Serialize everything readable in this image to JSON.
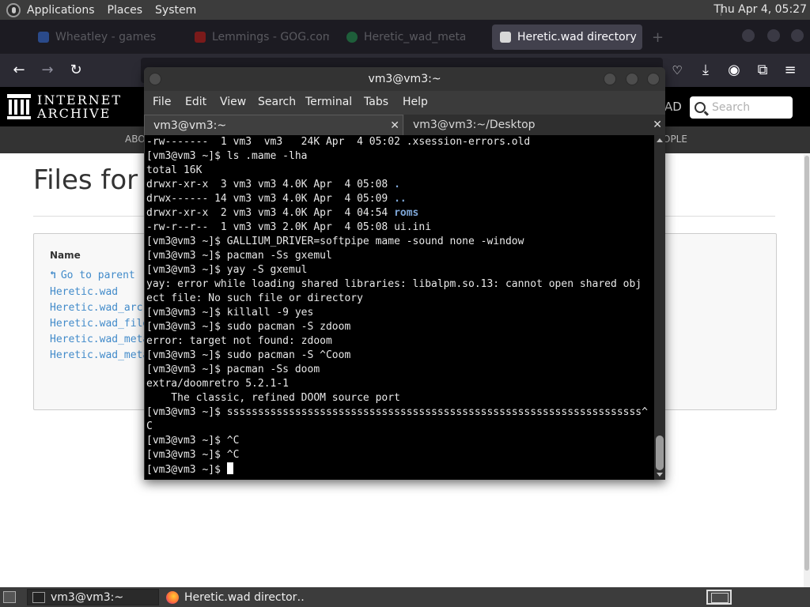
{
  "top_panel": {
    "menus": [
      "Applications",
      "Places",
      "System"
    ],
    "clock": "Thu Apr  4, 05:27"
  },
  "browser": {
    "tabs": [
      {
        "label": "Wheatley - games",
        "active": false
      },
      {
        "label": "Lemmings - GOG.com",
        "active": false
      },
      {
        "label": "Heretic_wad_metadata",
        "active": false
      },
      {
        "label": "Heretic.wad directory",
        "active": true
      }
    ],
    "new_tab": "+"
  },
  "ia_page": {
    "wordmark_line1": "INTERNET",
    "wordmark_line2": "ARCHIVE",
    "search_placeholder": "Search",
    "header_fragment": "AD",
    "subnav_left": "ABO",
    "subnav_right": "OPLE",
    "title": "Files for",
    "files_header": "Name",
    "parent_link": "Go to parent",
    "files": [
      "Heretic.wad",
      "Heretic.wad_arc",
      "Heretic.wad_file",
      "Heretic.wad_meta",
      "Heretic.wad_meta"
    ]
  },
  "terminal": {
    "title": "vm3@vm3:~",
    "menus": [
      "File",
      "Edit",
      "View",
      "Search",
      "Terminal",
      "Tabs",
      "Help"
    ],
    "tabs": [
      {
        "label": "vm3@vm3:~",
        "active": true
      },
      {
        "label": "vm3@vm3:~/Desktop",
        "active": false
      }
    ],
    "lines": [
      {
        "text": "-rw-------  1 vm3  vm3   24K Apr  4 05:02 .xsession-errors.old"
      },
      {
        "text": "[vm3@vm3 ~]$ ls .mame -lha"
      },
      {
        "text": "total 16K"
      },
      {
        "text": "drwxr-xr-x  3 vm3 vm3 4.0K Apr  4 05:08 ",
        "dir": "."
      },
      {
        "text": "drwx------ 14 vm3 vm3 4.0K Apr  4 05:09 ",
        "dir": ".."
      },
      {
        "text": "drwxr-xr-x  2 vm3 vm3 4.0K Apr  4 04:54 ",
        "dir": "roms"
      },
      {
        "text": "-rw-r--r--  1 vm3 vm3 2.0K Apr  4 05:08 ui.ini"
      },
      {
        "text": "[vm3@vm3 ~]$ GALLIUM_DRIVER=softpipe mame -sound none -window"
      },
      {
        "text": "[vm3@vm3 ~]$ pacman -Ss gxemul"
      },
      {
        "text": "[vm3@vm3 ~]$ yay -S gxemul"
      },
      {
        "text": "yay: error while loading shared libraries: libalpm.so.13: cannot open shared obj"
      },
      {
        "text": "ect file: No such file or directory"
      },
      {
        "text": "[vm3@vm3 ~]$ killall -9 yes"
      },
      {
        "text": "[vm3@vm3 ~]$ sudo pacman -S zdoom"
      },
      {
        "text": "error: target not found: zdoom"
      },
      {
        "text": "[vm3@vm3 ~]$ sudo pacman -S ^Coom"
      },
      {
        "text": "[vm3@vm3 ~]$ pacman -Ss doom"
      },
      {
        "text": "extra/doomretro 5.2.1-1"
      },
      {
        "text": "    The classic, refined DOOM source port"
      },
      {
        "text": "[vm3@vm3 ~]$ sssssssssssssssssssssssssssssssssssssssssssssssssssssssssssssssssss^"
      },
      {
        "text": "C"
      },
      {
        "text": "[vm3@vm3 ~]$ ^C"
      },
      {
        "text": "[vm3@vm3 ~]$ ^C"
      },
      {
        "text": "[vm3@vm3 ~]$ ",
        "cursor": true
      }
    ]
  },
  "taskbar": {
    "tasks": [
      {
        "label": "vm3@vm3:~",
        "icon": "terminal-icon",
        "active": true
      },
      {
        "label": "Heretic.wad director…",
        "icon": "firefox-icon",
        "active": false
      }
    ]
  },
  "colors": {
    "terminal_dir": "#7ea7d8",
    "ia_link": "#428bca",
    "panel_bg": "#3c3c3c"
  }
}
